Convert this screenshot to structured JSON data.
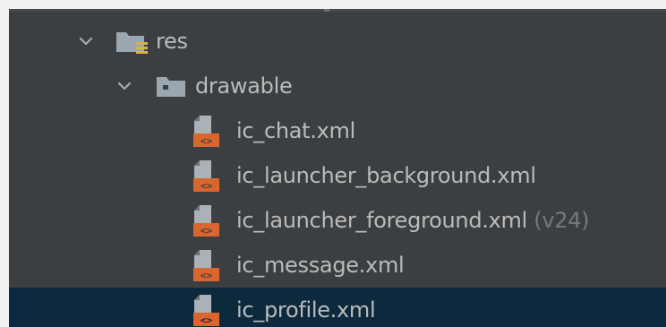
{
  "tree": {
    "res": {
      "label": "res",
      "icon": "resource-folder-icon",
      "expanded": true
    },
    "drawable": {
      "label": "drawable",
      "icon": "folder-icon",
      "expanded": true
    },
    "files": [
      {
        "label": "ic_chat.xml",
        "suffix": "",
        "icon": "vector-drawable-xml-icon",
        "selected": false
      },
      {
        "label": "ic_launcher_background.xml",
        "suffix": "",
        "icon": "vector-drawable-xml-icon",
        "selected": false
      },
      {
        "label": "ic_launcher_foreground.xml",
        "suffix": "(v24)",
        "icon": "vector-drawable-xml-icon",
        "selected": false
      },
      {
        "label": "ic_message.xml",
        "suffix": "",
        "icon": "vector-drawable-xml-icon",
        "selected": false
      },
      {
        "label": "ic_profile.xml",
        "suffix": "",
        "icon": "vector-drawable-xml-icon",
        "selected": true
      }
    ]
  },
  "colors": {
    "panel_bg": "#3c3f41",
    "selection_bg": "#0d293e",
    "text": "#bbbbbb",
    "suffix_text": "#787878",
    "xml_icon_orange": "#d9662e"
  }
}
